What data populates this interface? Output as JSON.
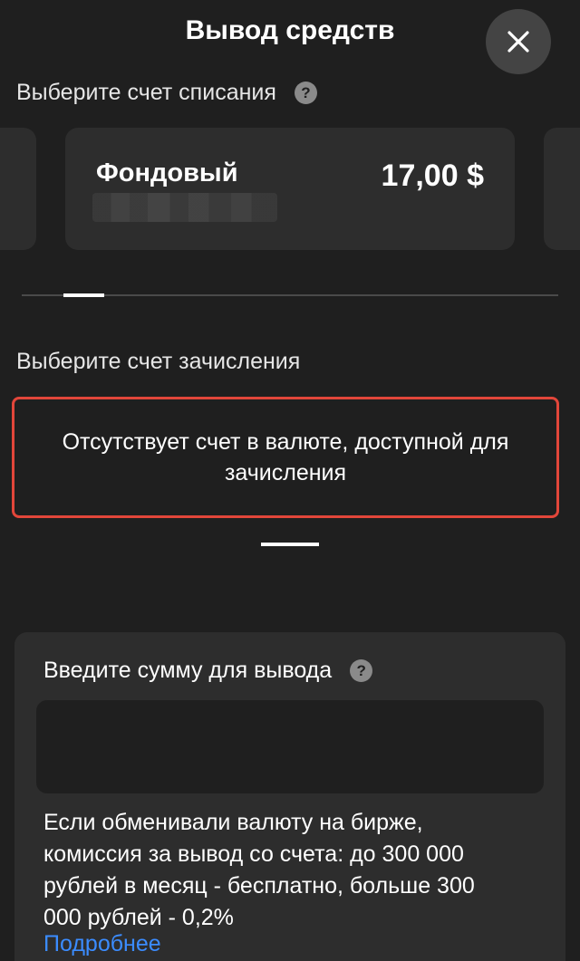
{
  "header": {
    "title": "Вывод средств"
  },
  "source": {
    "label": "Выберите счет списания",
    "account": {
      "name": "Фондовый",
      "balance": "17,00 $"
    }
  },
  "target": {
    "label": "Выберите счет зачисления",
    "empty_message": "Отсутствует счет в валюте, доступной для зачисления"
  },
  "amount": {
    "label": "Введите сумму для вывода",
    "value": "",
    "info": "Если обменивали валюту на бирже, комиссия за вывод со счета: до 300 000 рублей в месяц - бесплатно, больше 300 000 рублей - 0,2%",
    "more_link": "Подробнее"
  },
  "icons": {
    "help": "?",
    "close": "close-icon"
  },
  "colors": {
    "background": "#1f1f1f",
    "card": "#2d2d2d",
    "error_border": "#e2463a",
    "link": "#3b8cff"
  }
}
